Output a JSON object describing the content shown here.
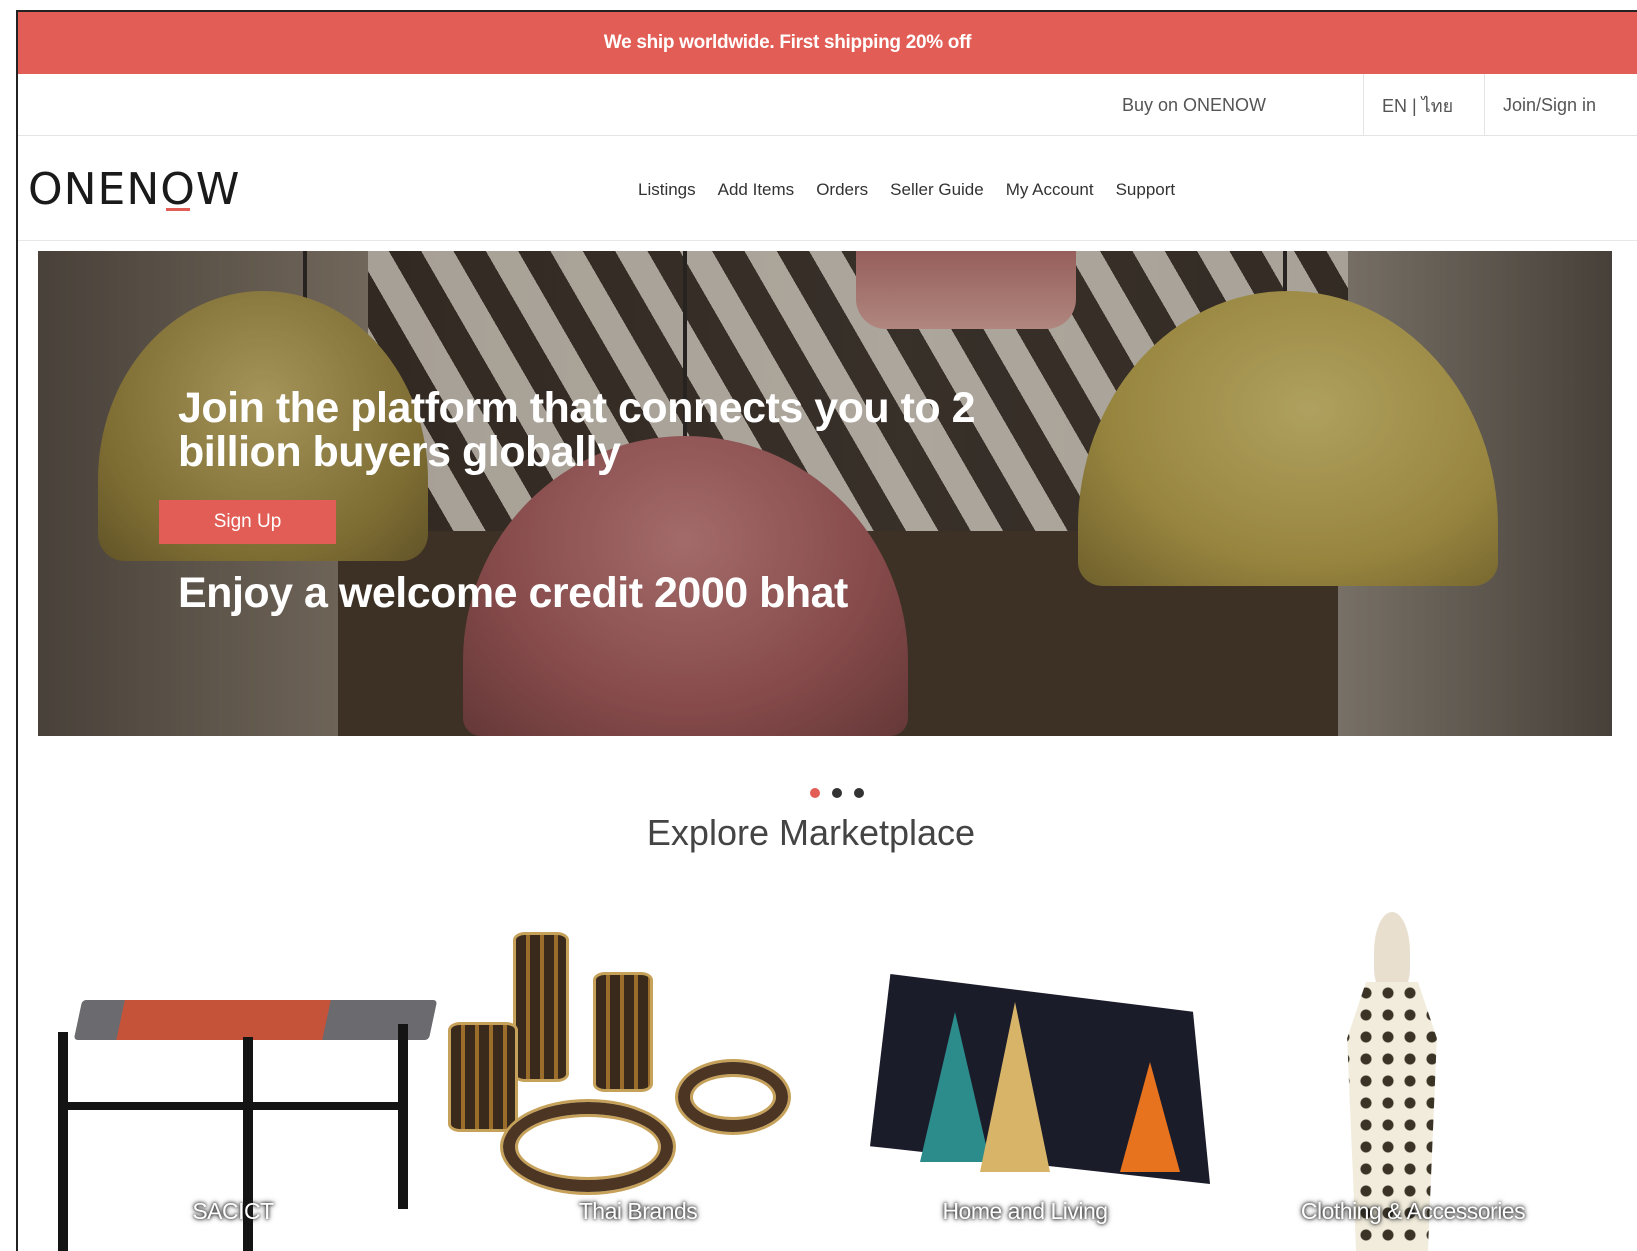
{
  "announcement": "We ship worldwide. First shipping 20% off",
  "utility": {
    "buy": "Buy on ONENOW",
    "lang": "EN | ไทย",
    "join": "Join/Sign in"
  },
  "brand": {
    "logo_a": "ONEN",
    "logo_o": "O",
    "logo_b": "W",
    "accent": "#e15d55"
  },
  "nav": [
    "Listings",
    "Add Items",
    "Orders",
    "Seller Guide",
    "My Account",
    "Support"
  ],
  "hero": {
    "title": "Join the platform that connects you to 2 billion buyers globally",
    "cta": "Sign Up",
    "credit": "Enjoy a welcome credit 2000 bhat"
  },
  "carousel": {
    "slides": 3,
    "active": 1
  },
  "section_title": "Explore Marketplace",
  "categories": [
    "SACICT",
    "Thai Brands",
    "Home and Living",
    "Clothing & Accessories"
  ]
}
